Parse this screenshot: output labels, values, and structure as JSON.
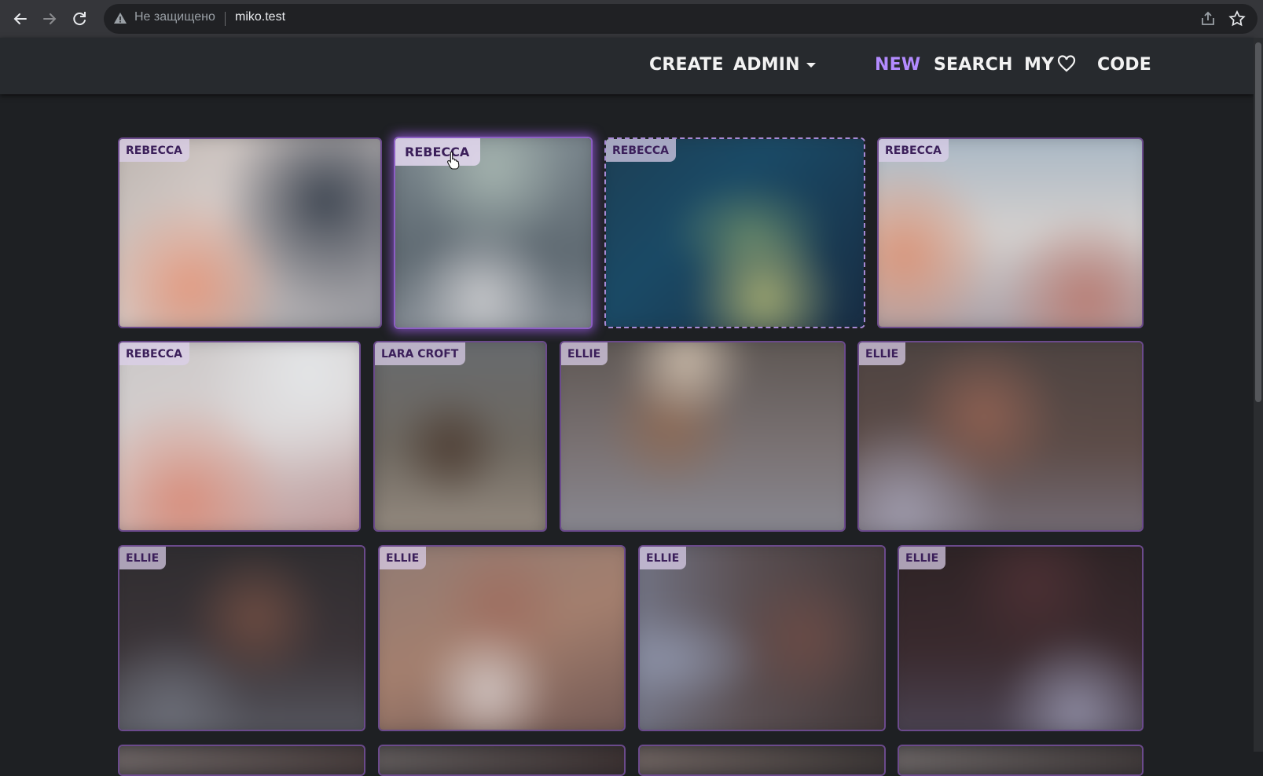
{
  "browser": {
    "security_label": "Не защищено",
    "url": "miko.test",
    "icons": [
      "back-icon",
      "forward-icon",
      "reload-icon",
      "warning-icon",
      "share-icon",
      "star-icon"
    ]
  },
  "header": {
    "menu": {
      "create": "CREATE",
      "admin": "ADMIN",
      "new": "NEW",
      "search": "SEARCH",
      "my": "MY",
      "code": "CODE"
    },
    "active_item": "NEW",
    "accent_color": "#b38bff"
  },
  "gallery": {
    "cards": [
      {
        "tag": "REBECCA"
      },
      {
        "tag": "REBECCA"
      },
      {
        "tag": "REBECCA"
      },
      {
        "tag": "REBECCA"
      },
      {
        "tag": "REBECCA"
      },
      {
        "tag": "LARA CROFT"
      },
      {
        "tag": "ELLIE"
      },
      {
        "tag": "ELLIE"
      },
      {
        "tag": "ELLIE"
      },
      {
        "tag": "ELLIE"
      },
      {
        "tag": "ELLIE"
      },
      {
        "tag": "ELLIE"
      }
    ],
    "hovered_card": 2,
    "selected_card": 3
  }
}
